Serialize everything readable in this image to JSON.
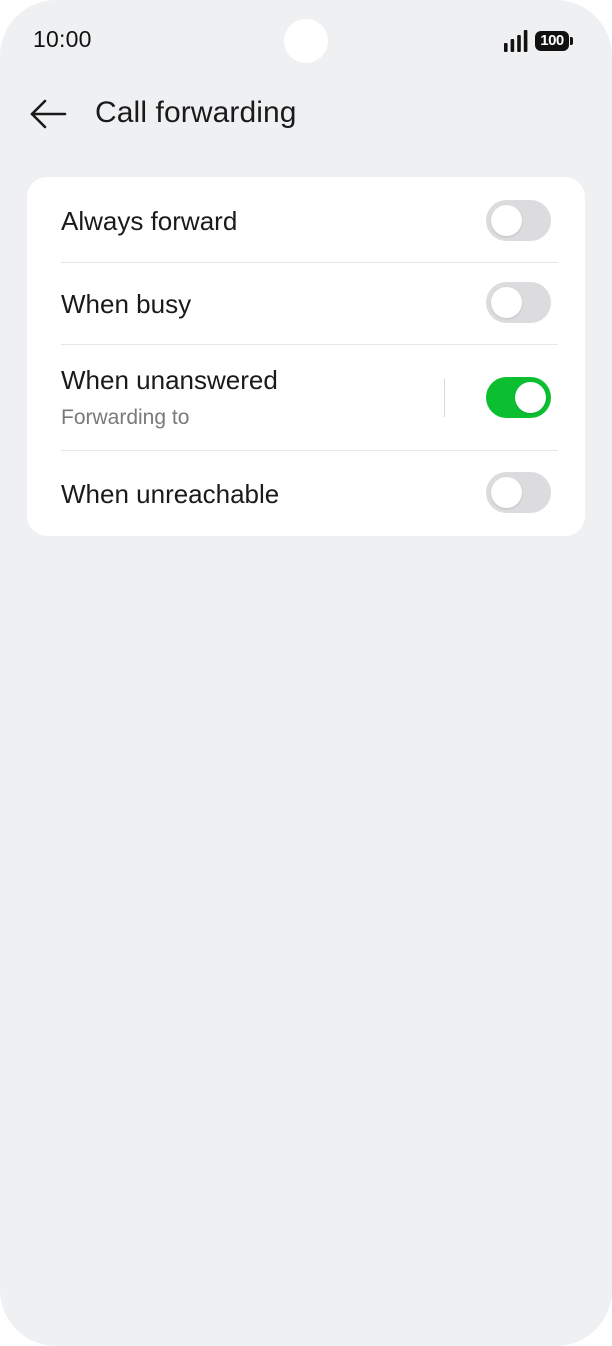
{
  "status_bar": {
    "time": "10:00",
    "battery_level": "100",
    "signal_icon": "cellular-signal-icon"
  },
  "app_bar": {
    "back_icon": "arrow-left-icon",
    "title": "Call forwarding"
  },
  "forwarding_options": [
    {
      "label": "Always forward",
      "subtitle": "",
      "enabled": false
    },
    {
      "label": "When busy",
      "subtitle": "",
      "enabled": false
    },
    {
      "label": "When unanswered",
      "subtitle": "Forwarding to",
      "enabled": true
    },
    {
      "label": "When unreachable",
      "subtitle": "",
      "enabled": false
    }
  ],
  "colors": {
    "background": "#eff0f2",
    "card": "#ffffff",
    "toggle_on": "#0bbf31",
    "toggle_off": "#dcdcde"
  }
}
